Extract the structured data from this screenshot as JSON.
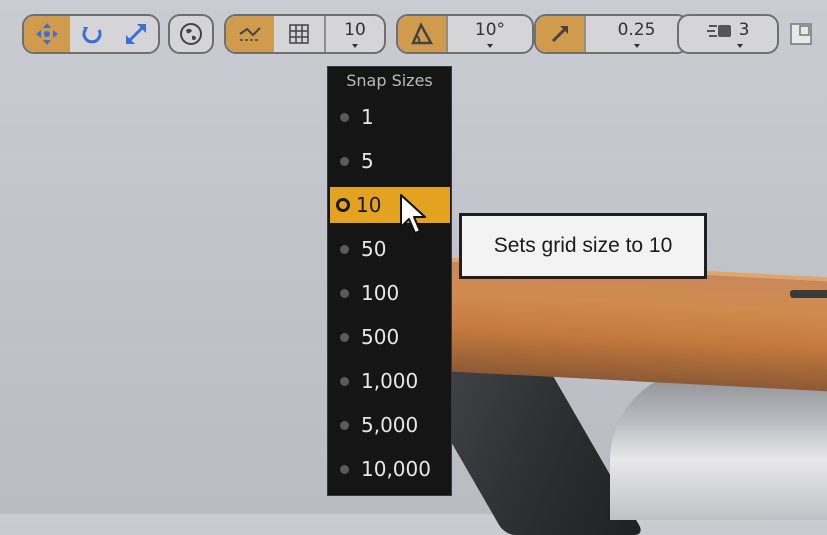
{
  "toolbar": {
    "transform_tools": [
      "translate-icon",
      "rotate-icon",
      "scale-icon"
    ],
    "world_local_icon": "globe-icon",
    "grid_snap_icon": "grid-snap-icon",
    "grid_icon": "grid-icon",
    "grid_snap_value": "10",
    "rotation_snap_icon": "angle-icon",
    "rotation_snap_value": "10°",
    "scale_snap_icon": "scale-arrow-icon",
    "scale_snap_value": "0.25",
    "camera_speed_icon": "camera-speed-icon",
    "camera_speed_value": "3",
    "maximize_icon": "maximize-icon"
  },
  "snap_menu": {
    "header": "Snap Sizes",
    "items": [
      "1",
      "5",
      "10",
      "50",
      "100",
      "500",
      "1,000",
      "5,000",
      "10,000"
    ],
    "selected": "10"
  },
  "tooltip": {
    "text": "Sets grid size to 10"
  },
  "colors": {
    "active_segment": "#d19b4e",
    "selected_item": "#e3a321",
    "menu_background": "#151515"
  }
}
